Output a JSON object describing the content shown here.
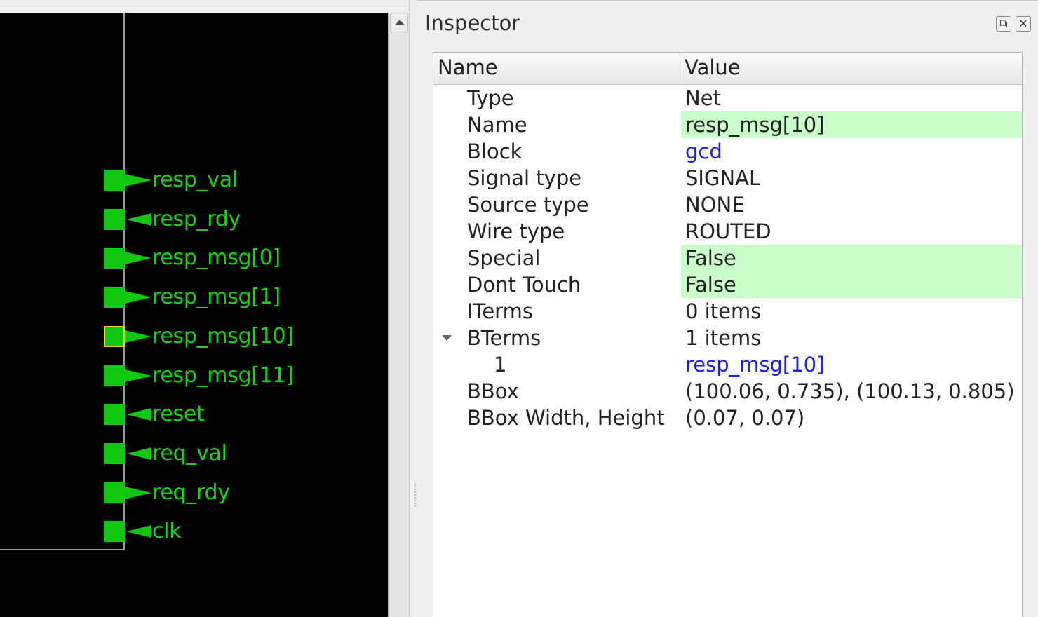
{
  "layout": {
    "pins": [
      {
        "label": "resp_val",
        "dir": "out",
        "selected": false
      },
      {
        "label": "resp_rdy",
        "dir": "in",
        "selected": false
      },
      {
        "label": "resp_msg[0]",
        "dir": "out",
        "selected": false
      },
      {
        "label": "resp_msg[1]",
        "dir": "out",
        "selected": false
      },
      {
        "label": "resp_msg[10]",
        "dir": "out",
        "selected": true
      },
      {
        "label": "resp_msg[11]",
        "dir": "out",
        "selected": false
      },
      {
        "label": "reset",
        "dir": "in",
        "selected": false
      },
      {
        "label": "req_val",
        "dir": "in",
        "selected": false
      },
      {
        "label": "req_rdy",
        "dir": "out",
        "selected": false
      },
      {
        "label": "clk",
        "dir": "in",
        "selected": false
      }
    ],
    "colors": {
      "pin": "#10c810",
      "selection": "#e8e000",
      "background": "#000000"
    }
  },
  "inspector": {
    "title": "Inspector",
    "float_icon": "float-icon",
    "close_icon": "close-icon",
    "columns": {
      "name": "Name",
      "value": "Value"
    },
    "rows": [
      {
        "name": "Type",
        "value": "Net",
        "style": "plain"
      },
      {
        "name": "Name",
        "value": "resp_msg[10]",
        "style": "editable"
      },
      {
        "name": "Block",
        "value": "gcd",
        "style": "link"
      },
      {
        "name": "Signal type",
        "value": "SIGNAL",
        "style": "plain"
      },
      {
        "name": "Source type",
        "value": "NONE",
        "style": "plain"
      },
      {
        "name": "Wire type",
        "value": "ROUTED",
        "style": "plain"
      },
      {
        "name": "Special",
        "value": "False",
        "style": "editable"
      },
      {
        "name": "Dont Touch",
        "value": "False",
        "style": "editable"
      },
      {
        "name": "ITerms",
        "value": "0 items",
        "style": "plain"
      },
      {
        "name": "BTerms",
        "value": "1 items",
        "style": "plain",
        "expanded": true
      },
      {
        "name": "1",
        "value": "resp_msg[10]",
        "style": "link",
        "child": true
      },
      {
        "name": "BBox",
        "value": "(100.06, 0.735), (100.13, 0.805)",
        "style": "plain"
      },
      {
        "name": "BBox Width, Height",
        "value": "(0.07, 0.07)",
        "style": "plain"
      }
    ],
    "colors": {
      "editable_bg": "#c9fdc9",
      "link": "#2020e6"
    }
  }
}
